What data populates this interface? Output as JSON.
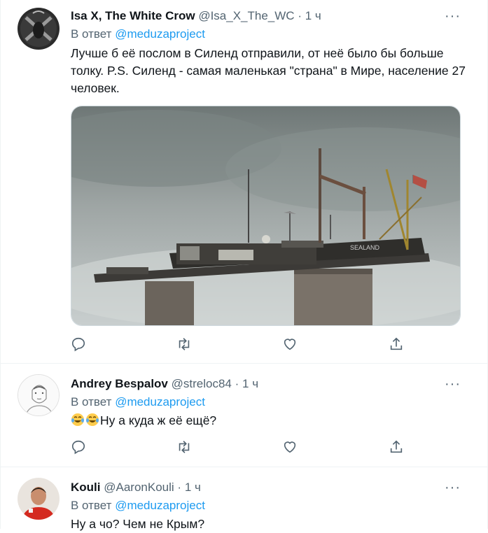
{
  "tweets": [
    {
      "display_name": "Isa X, The White Crow",
      "handle": "@Isa_X_The_WC",
      "separator": "·",
      "time": "1 ч",
      "reply_prefix": "В ответ",
      "reply_to": "@meduzaproject",
      "text": "Лучше б её послом в Силенд отправили, от неё было бы больше толку. P.S. Силенд - самая маленькая \"страна\" в Мире, население 27 человек.",
      "media_sign": "SEALAND"
    },
    {
      "display_name": "Andrey Bespalov",
      "handle": "@streloc84",
      "separator": "·",
      "time": "1 ч",
      "reply_prefix": "В ответ",
      "reply_to": "@meduzaproject",
      "text": "Ну а куда ж её ещё?"
    },
    {
      "display_name": "Kouli",
      "handle": "@AaronKouli",
      "separator": "·",
      "time": "1 ч",
      "reply_prefix": "В ответ",
      "reply_to": "@meduzaproject",
      "text": "Ну а чо? Чем не Крым?"
    }
  ],
  "icons": [
    "reply-icon",
    "retweet-icon",
    "like-icon",
    "share-icon",
    "more-icon",
    "tears-of-joy-emoji"
  ],
  "colors": {
    "link": "#1d9bf0",
    "secondary": "#536471",
    "divider": "#eff3f4",
    "text": "#0f1419"
  }
}
